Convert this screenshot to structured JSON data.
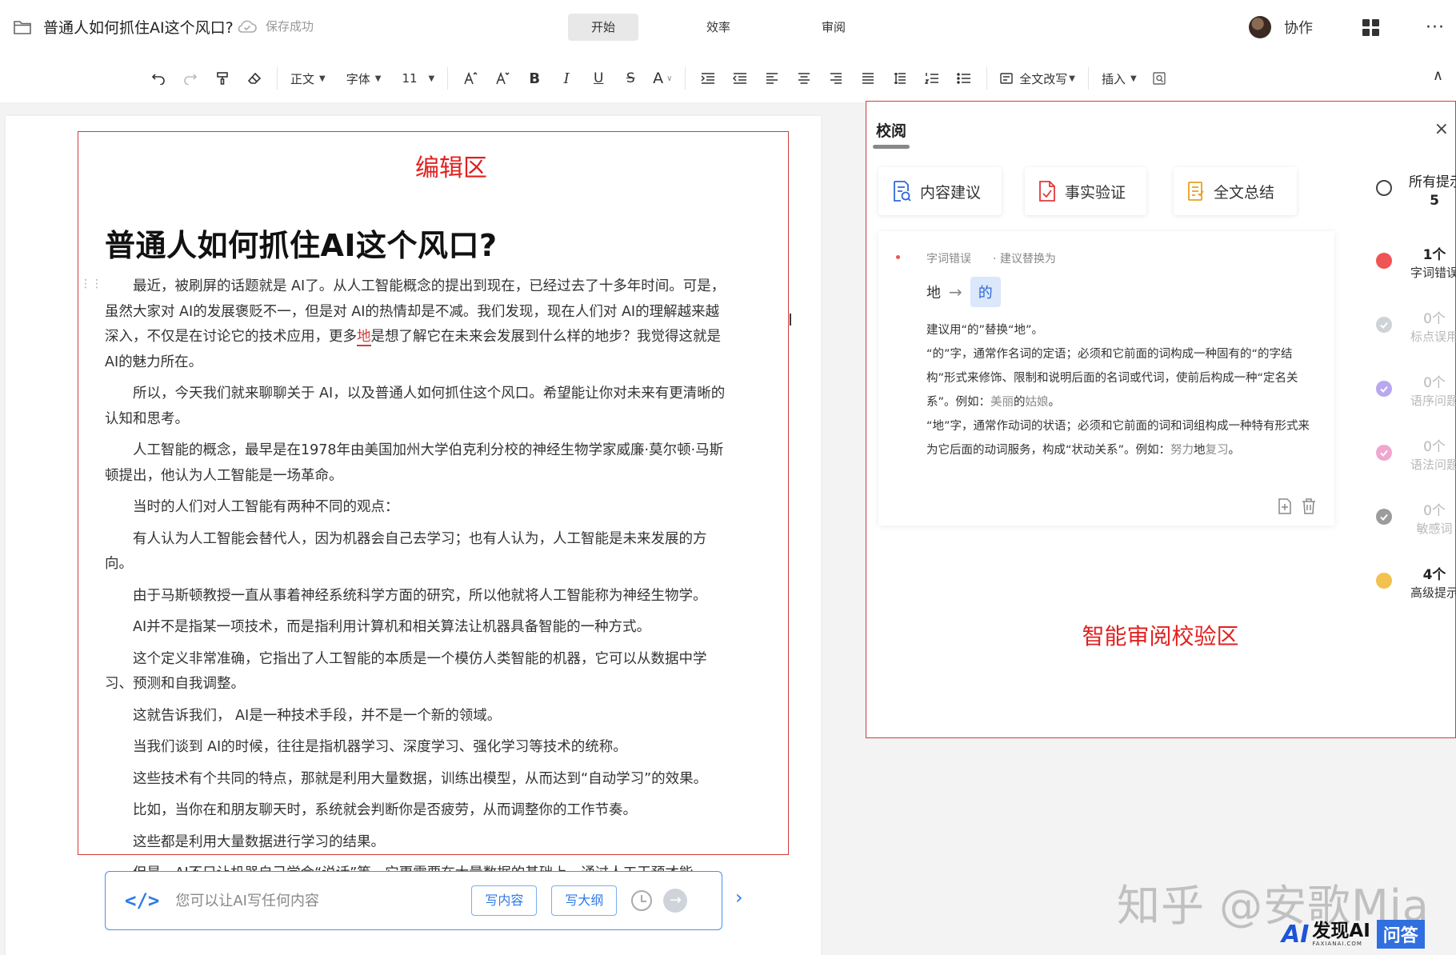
{
  "header": {
    "doc_title": "普通人如何抓住AI这个风口?",
    "save_status": "保存成功",
    "tabs": [
      {
        "label": "开始",
        "active": true
      },
      {
        "label": "效率",
        "active": false
      },
      {
        "label": "审阅",
        "active": false
      }
    ],
    "collab_label": "协作",
    "more_glyph": "···"
  },
  "toolbar": {
    "style_dd": "正文",
    "font_dd": "字体",
    "size_dd": "11",
    "bold": "B",
    "italic": "I",
    "underline": "U",
    "strike": "S",
    "font_color": "A",
    "rewrite_dd": "全文改写",
    "insert_dd": "插入",
    "caret": "▼",
    "collapse_glyph": "∧"
  },
  "editor": {
    "zone_label": "编辑区",
    "heading": "普通人如何抓住AI这个风口?",
    "p1_before": "最近，被刷屏的话题就是 AI了。从人工智能概念的提出到现在，已经过去了十多年时间。可是，虽然大家对 AI的发展褒贬不一，但是对 AI的热情却是不减。我们发现，现在人们对 AI的理解越来越深入，不仅是在讨论它的技术应用，更多",
    "p1_error": "地",
    "p1_after": "是想了解它在未来会发展到什么样的地步？我觉得这就是 AI的魅力所在。",
    "paragraphs": [
      "所以，今天我们就来聊聊关于 AI，以及普通人如何抓住这个风口。希望能让你对未来有更清晰的认知和思考。",
      "人工智能的概念，最早是在1978年由美国加州大学伯克利分校的神经生物学家威廉·莫尔顿·马斯顿提出，他认为人工智能是一场革命。",
      "当时的人们对人工智能有两种不同的观点：",
      "有人认为人工智能会替代人，因为机器会自己去学习；也有人认为，人工智能是未来发展的方向。",
      "由于马斯顿教授一直从事着神经系统科学方面的研究，所以他就将人工智能称为神经生物学。",
      "AI并不是指某一项技术，而是指利用计算机和相关算法让机器具备智能的一种方式。",
      "这个定义非常准确，它指出了人工智能的本质是一个模仿人类智能的机器，它可以从数据中学习、预测和自我调整。",
      "这就告诉我们， AI是一种技术手段，并不是一个新的领域。",
      "当我们谈到 AI的时候，往往是指机器学习、深度学习、强化学习等技术的统称。",
      "这些技术有个共同的特点，那就是利用大量数据，训练出模型，从而达到“自动学习”的效果。",
      "比如，当你在和朋友聊天时，系统就会判断你是否疲劳，从而调整你的工作节奏。",
      "这些都是利用大量数据进行学习的结果。",
      "但是，AI不只让机器自己学会“说话”等，它更需要在大量数据的基础上，通过人工干预才能"
    ],
    "cursor_glyph": "I"
  },
  "ai_bar": {
    "placeholder": "您可以让AI写任何内容",
    "btn_content": "写内容",
    "btn_outline": "写大纲",
    "code_glyph": "</>",
    "send_glyph": "→",
    "next_glyph": "›"
  },
  "proofread": {
    "title": "校阅",
    "close_glyph": "×",
    "features": [
      {
        "label": "内容建议",
        "icon": "content-suggest-icon"
      },
      {
        "label": "事实验证",
        "icon": "fact-check-icon"
      },
      {
        "label": "全文总结",
        "icon": "summary-icon"
      }
    ],
    "issue": {
      "type": "字词错误",
      "suggest_label": "· 建议替换为",
      "from": "地",
      "arrow": "→",
      "to": "的",
      "line1": "建议用“的”替换“地”。",
      "line2": "“的”字，通常作名词的定语；必须和它前面的词构成一种固有的“的字结构”形式来修饰、限制和说明后面的名词或代词，使前后构成一种“定名关系”。例如：",
      "ex1_a": "美丽",
      "ex1_b": "的",
      "ex1_c": "姑娘",
      "ex1_end": "。",
      "line3": "“地”字，通常作动词的状语；必须和它前面的词和词组构成一种特有形式来为它后面的动词服务，构成“状动关系”。例如：",
      "ex2_a": "努力",
      "ex2_b": "地",
      "ex2_c": "复习",
      "ex2_end": "。"
    },
    "categories": [
      {
        "count": "所有提示",
        "name": "5",
        "color": "#ffffff",
        "dim": false
      },
      {
        "count": "1个",
        "name": "字词错误",
        "color": "#f05454",
        "dim": false
      },
      {
        "count": "0个",
        "name": "标点误用",
        "color": "#cfd3d8",
        "dim": true
      },
      {
        "count": "0个",
        "name": "语序问题",
        "color": "#b9a7f0",
        "dim": true
      },
      {
        "count": "0个",
        "name": "语法问题",
        "color": "#f0a7cf",
        "dim": true
      },
      {
        "count": "0个",
        "name": "敏感词",
        "color": "#9c9c9c",
        "dim": true
      },
      {
        "count": "4个",
        "name": "高级提示",
        "color": "#f2c14e",
        "dim": false
      }
    ],
    "zone_label": "智能审阅校验区"
  },
  "watermark": {
    "zhihu": "知乎 @安歌Mia",
    "brand_ai": "AI",
    "brand_cn": "发现AI",
    "brand_en": "FAXIANAI.COM",
    "brand_wenda": "问答"
  }
}
